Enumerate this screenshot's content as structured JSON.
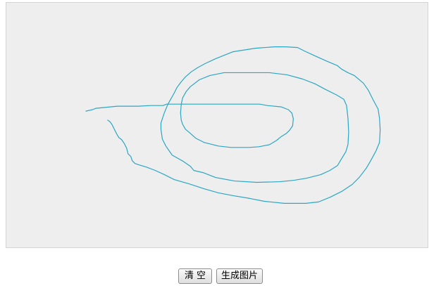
{
  "canvas": {
    "background": "#eeeeee",
    "stroke_color": "#2aa6c5"
  },
  "buttons": {
    "clear_label": "清空",
    "generate_label": "生成图片"
  }
}
